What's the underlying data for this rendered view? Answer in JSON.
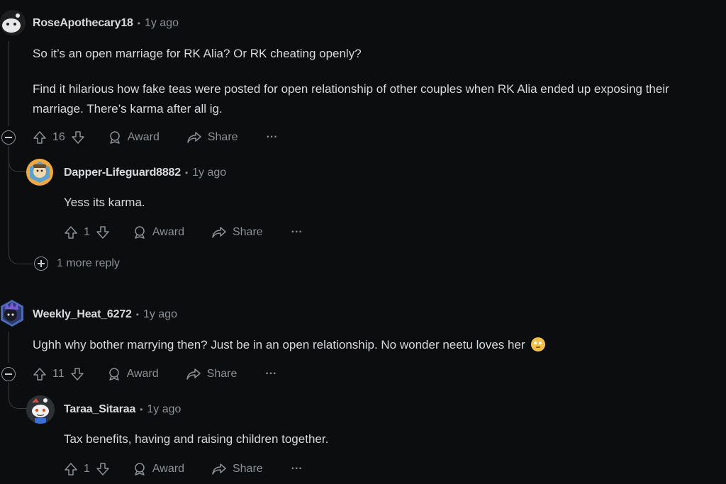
{
  "comments": [
    {
      "author": "RoseApothecary18",
      "time": "1y ago",
      "paragraphs": [
        "So it’s an open marriage for RK Alia? Or RK cheating openly?",
        "Find it hilarious how fake teas were posted for open relationship of other couples when RK Alia ended up exposing their marriage. There’s karma after all ig."
      ],
      "votes": "16",
      "award_label": "Award",
      "share_label": "Share",
      "more_label": "···",
      "reply": {
        "author": "Dapper-Lifeguard8882",
        "time": "1y ago",
        "text": "Yess its karma.",
        "votes": "1",
        "award_label": "Award",
        "share_label": "Share",
        "more_label": "···"
      },
      "more_replies": "1 more reply"
    },
    {
      "author": "Weekly_Heat_6272",
      "time": "1y ago",
      "text": "Ughh why bother marrying then? Just be in an open relationship. No wonder neetu loves her",
      "emoji": "face-with-rolling-eyes",
      "votes": "11",
      "award_label": "Award",
      "share_label": "Share",
      "more_label": "···",
      "reply": {
        "author": "Taraa_Sitaraa",
        "time": "1y ago",
        "text": "Tax benefits, having and raising children together.",
        "votes": "1",
        "award_label": "Award",
        "share_label": "Share",
        "more_label": "···"
      }
    }
  ],
  "separator": "•",
  "colors": {
    "background": "#0b0d0f",
    "text": "#d7dadc",
    "muted": "#8b9196",
    "line": "#3a3d40"
  }
}
